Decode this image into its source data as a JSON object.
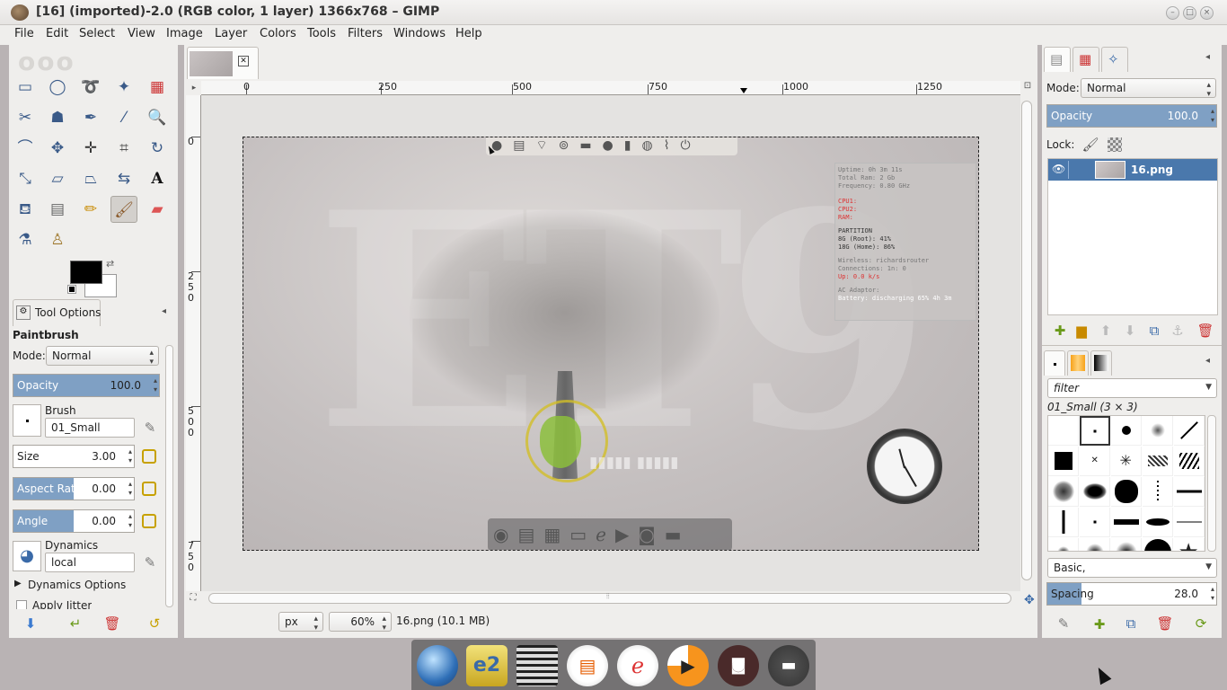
{
  "window": {
    "title": "[16] (imported)-2.0 (RGB color, 1 layer) 1366x768 – GIMP",
    "controls": {
      "minimize": "–",
      "maximize": "□",
      "close": "×"
    }
  },
  "menu": [
    "File",
    "Edit",
    "Select",
    "View",
    "Image",
    "Layer",
    "Colors",
    "Tools",
    "Filters",
    "Windows",
    "Help"
  ],
  "toolbox": {
    "tools": [
      "rect-select",
      "ellipse-select",
      "free-select",
      "fuzzy-select",
      "select-by-color",
      "scissors-select",
      "foreground-select",
      "paths",
      "color-picker",
      "zoom",
      "measure",
      "move",
      "align",
      "crop",
      "rotate",
      "scale",
      "shear",
      "perspective",
      "flip",
      "text",
      "bucket-fill",
      "blend",
      "pencil",
      "paintbrush",
      "eraser",
      "airbrush",
      "clone"
    ],
    "tool_options": {
      "tab_label": "Tool Options",
      "tool_name": "Paintbrush",
      "mode_label": "Mode:",
      "mode_value": "Normal",
      "opacity": {
        "label": "Opacity",
        "value": "100.0",
        "fraction": 1.0
      },
      "brush_label": "Brush",
      "brush_value": "01_Small",
      "size": {
        "label": "Size",
        "value": "3.00"
      },
      "aspect_ratio": {
        "label": "Aspect Ratio",
        "value": "0.00",
        "fraction": 0.5
      },
      "angle": {
        "label": "Angle",
        "value": "0.00",
        "fraction": 0.5
      },
      "dynamics_label": "Dynamics",
      "dynamics_value": "local",
      "dynamics_options": "Dynamics Options",
      "apply_jitter": "Apply Jitter"
    }
  },
  "canvas": {
    "ruler_h": [
      "0",
      "250",
      "500",
      "750",
      "1000",
      "1250"
    ],
    "ruler_v": [
      "0",
      "250",
      "500",
      "750"
    ],
    "status": {
      "unit": "px",
      "zoom": "60%",
      "info": "16.png (10.1 MB)"
    },
    "conky": [
      "Uptime: 0h 3m 11s",
      "Total Ram: 2 Gb",
      "Frequency: 0.80 GHz",
      "CPU1:",
      "CPU2:",
      "RAM:",
      "PARTITION",
      "8G (Root): 41%",
      "18G (Home): 86%",
      "Wireless: richardsrouter",
      "Connections: 1n: 0",
      "Up: 0.0 k/s",
      "AC Adaptor:",
      "Battery: discharging 65% 4h 3m"
    ]
  },
  "layers": {
    "mode_label": "Mode:",
    "mode_value": "Normal",
    "opacity_label": "Opacity",
    "opacity_value": "100.0",
    "lock_label": "Lock:",
    "layer_name": "16.png"
  },
  "brushes": {
    "filter_placeholder": "filter",
    "current": "01_Small (3 × 3)",
    "category": "Basic,",
    "spacing_label": "Spacing",
    "spacing_value": "28.0",
    "spacing_fraction": 0.2
  }
}
